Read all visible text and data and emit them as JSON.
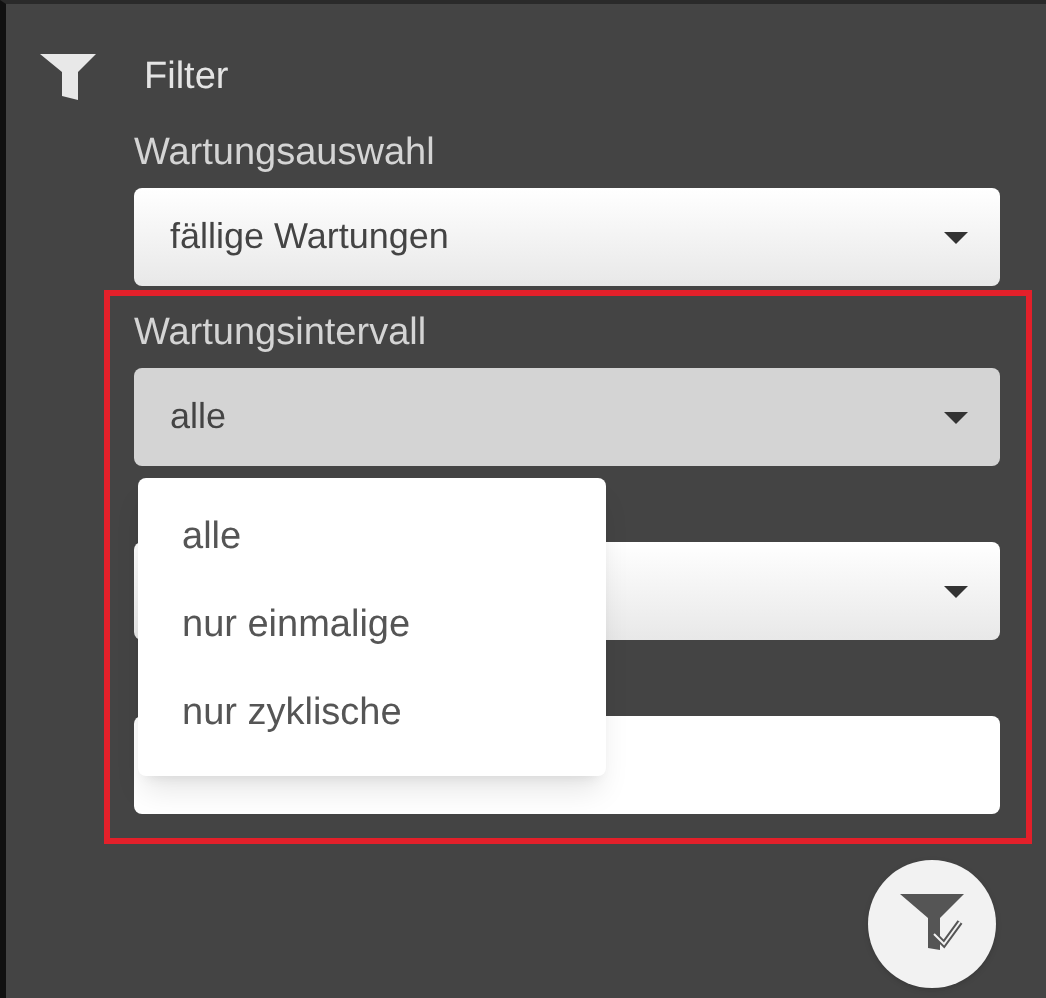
{
  "panel": {
    "title": "Filter"
  },
  "fields": [
    {
      "kind": "select",
      "label": "Wartungsauswahl",
      "value": "fällige Wartungen",
      "open": false
    }
  ],
  "highlight_frame": {
    "fields": [
      {
        "kind": "select",
        "label": "Wartungsintervall",
        "value": "alle",
        "open": true,
        "options": [
          "alle",
          "nur einmalige",
          "nur zyklische"
        ]
      },
      {
        "kind": "select",
        "open": false
      },
      {
        "kind": "text"
      }
    ]
  }
}
